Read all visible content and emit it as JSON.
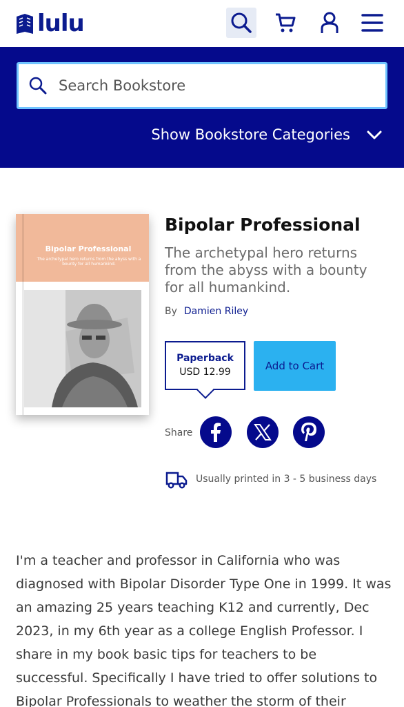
{
  "brand": {
    "name": "lulu",
    "color": "#0b1b8f"
  },
  "header": {
    "icons": [
      "search-icon",
      "cart-icon",
      "account-icon",
      "menu-icon"
    ]
  },
  "search": {
    "placeholder": "Search Bookstore"
  },
  "categories": {
    "label": "Show Bookstore Categories"
  },
  "book": {
    "cover_title": "Bipolar Professional",
    "cover_subtitle": "The archetypal hero returns from the abyss with a bounty for all humankind.",
    "title": "Bipolar Professional",
    "subtitle": "The archetypal hero returns from the abyss with a bounty for all humankind.",
    "by_label": "By",
    "author": "Damien Riley"
  },
  "purchase": {
    "format_name": "Paperback",
    "price": "USD 12.99",
    "add_to_cart": "Add to Cart"
  },
  "share": {
    "label": "Share",
    "networks": [
      "facebook-icon",
      "x-icon",
      "pinterest-icon"
    ]
  },
  "shipping": {
    "note": "Usually printed in 3 - 5 business days"
  },
  "description": "I'm a teacher and professor in California who was diagnosed with Bipolar Disorder Type One in 1999. It was an amazing 25 years teaching K12 and currently, Dec 2023, in my 6th year as a college English Professor. I share in my book basic tips for teachers to be successful. Specifically I have tried to offer solutions to Bipolar Professionals to weather the storm of their career. I see",
  "colors": {
    "navy": "#050a8c",
    "accent": "#2bb1f0",
    "search_border": "#6fc3ff",
    "cover_peach": "#f1b99a"
  }
}
